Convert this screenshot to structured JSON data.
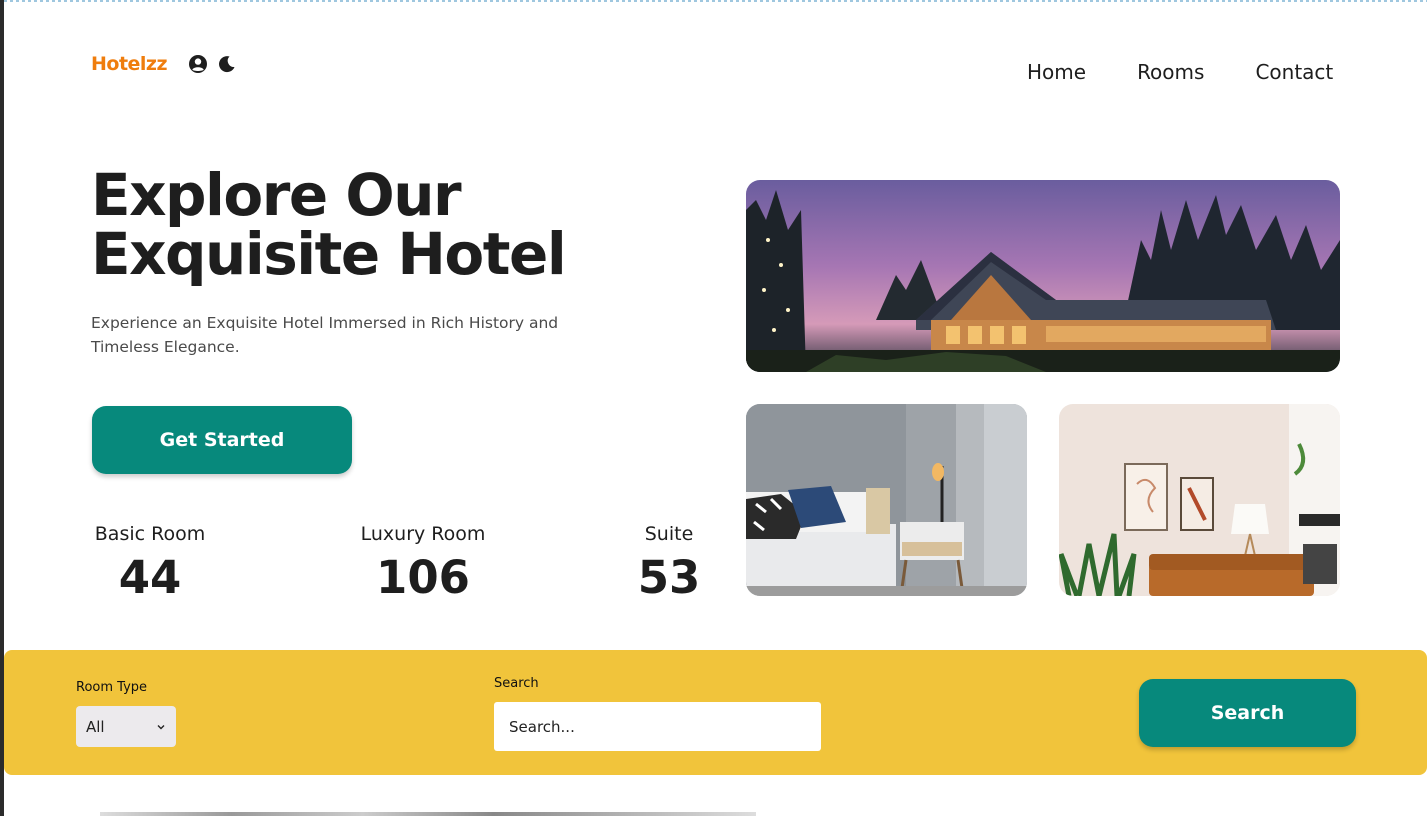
{
  "header": {
    "brand": "Hotelzz",
    "icons": [
      "user-circle-icon",
      "moon-icon"
    ],
    "nav": [
      "Home",
      "Rooms",
      "Contact"
    ]
  },
  "hero": {
    "title": "Explore Our Exquisite Hotel",
    "subtitle": "Experience an Exquisite Hotel Immersed in Rich History and Timeless Elegance.",
    "cta_label": "Get Started"
  },
  "stats": [
    {
      "label": "Basic Room",
      "value": "44"
    },
    {
      "label": "Luxury Room",
      "value": "106"
    },
    {
      "label": "Suite",
      "value": "53"
    }
  ],
  "images": [
    "hotel-exterior-dusk",
    "bedroom-interior",
    "living-room-interior"
  ],
  "search_bar": {
    "room_type_label": "Room Type",
    "room_type_value": "All",
    "search_label": "Search",
    "search_placeholder": "Search...",
    "button_label": "Search"
  },
  "colors": {
    "brand": "#ef7d0d",
    "primary": "#07897c",
    "band": "#f1c43b",
    "text": "#1e1e1e"
  }
}
